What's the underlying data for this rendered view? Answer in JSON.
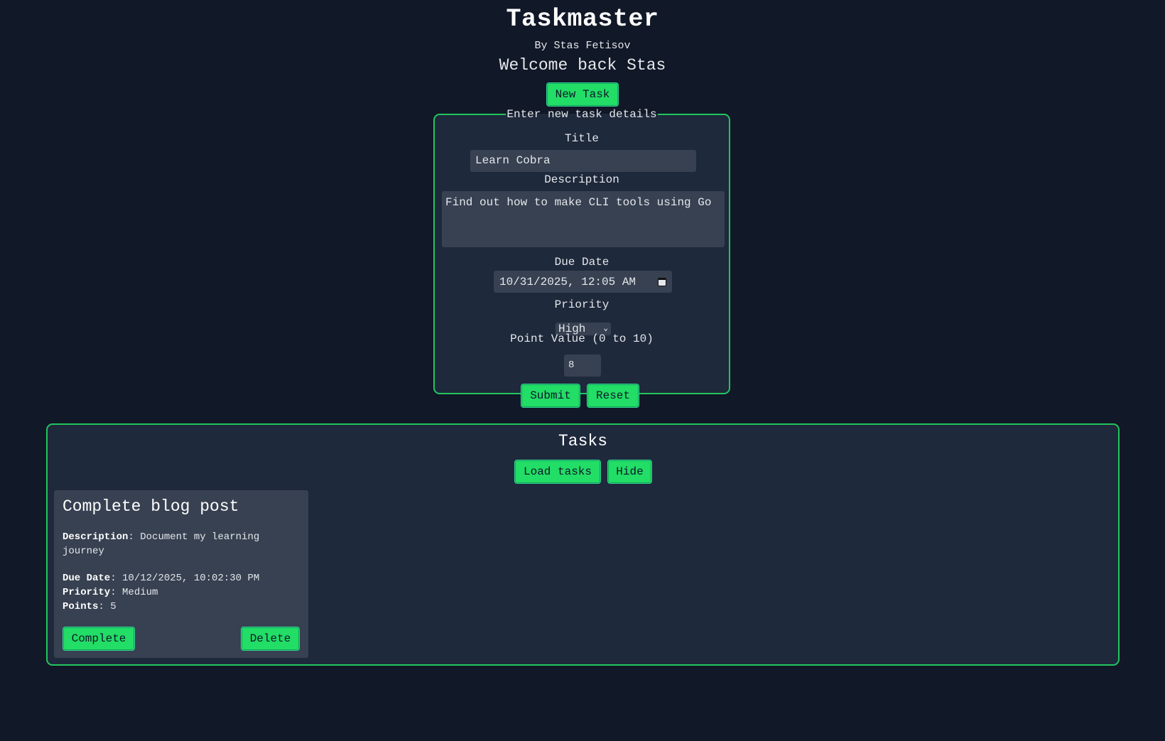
{
  "header": {
    "title": "Taskmaster",
    "byline": "By Stas Fetisov",
    "welcome": "Welcome back Stas"
  },
  "new_task_button": "New Task",
  "form": {
    "legend": "Enter new task details",
    "title_label": "Title",
    "title_value": "Learn Cobra",
    "description_label": "Description",
    "description_value": "Find out how to make CLI tools using Go",
    "due_label": "Due Date",
    "due_value": "10/31/2025, 12:05 AM",
    "priority_label": "Priority",
    "priority_value": "High",
    "points_label": "Point Value (0 to 10)",
    "points_value": "8",
    "submit": "Submit",
    "reset": "Reset"
  },
  "tasks": {
    "heading": "Tasks",
    "load_button": "Load tasks",
    "hide_button": "Hide",
    "items": [
      {
        "title": "Complete blog post",
        "description_key": "Description",
        "description": "Document my learning journey",
        "due_key": "Due Date",
        "due": "10/12/2025, 10:02:30 PM",
        "priority_key": "Priority",
        "priority": "Medium",
        "points_key": "Points",
        "points": "5",
        "complete_button": "Complete",
        "delete_button": "Delete"
      }
    ]
  },
  "colors": {
    "background": "#111827",
    "panel": "#1e293b",
    "field": "#374151",
    "accent": "#22dd66",
    "border": "#22c55e"
  }
}
